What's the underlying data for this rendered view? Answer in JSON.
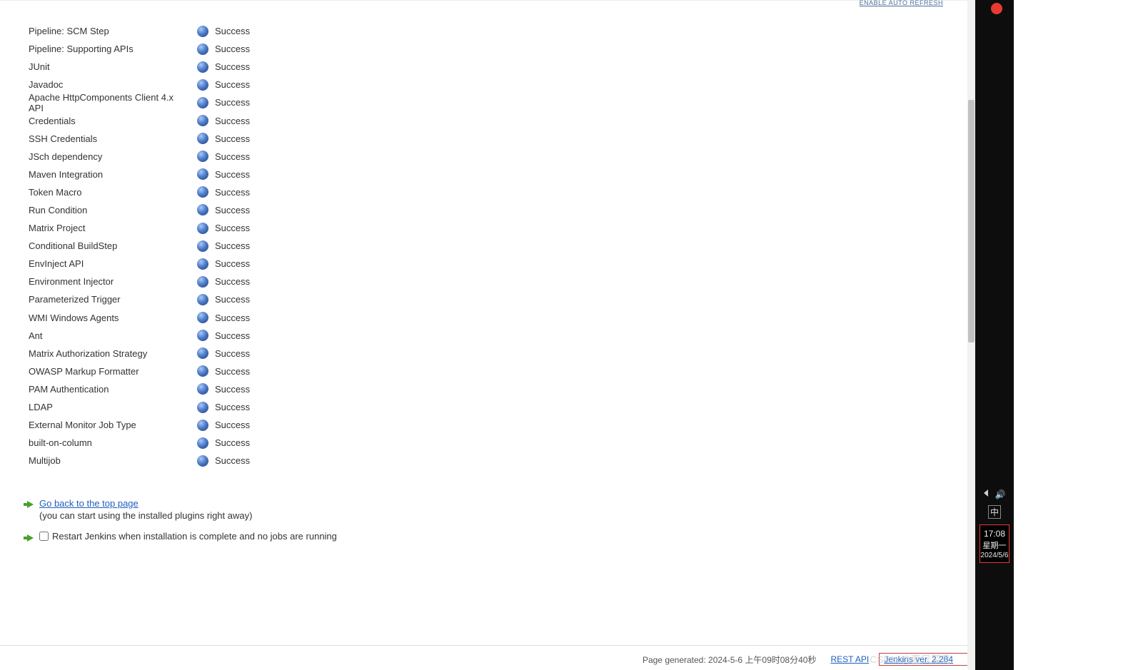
{
  "header": {
    "enable_auto_refresh": "ENABLE AUTO REFRESH"
  },
  "plugins": [
    {
      "name": "Pipeline: SCM Step",
      "status": "Success"
    },
    {
      "name": "Pipeline: Supporting APIs",
      "status": "Success"
    },
    {
      "name": "JUnit",
      "status": "Success"
    },
    {
      "name": "Javadoc",
      "status": "Success"
    },
    {
      "name": "Apache HttpComponents Client 4.x API",
      "status": "Success"
    },
    {
      "name": "Credentials",
      "status": "Success"
    },
    {
      "name": "SSH Credentials",
      "status": "Success"
    },
    {
      "name": "JSch dependency",
      "status": "Success"
    },
    {
      "name": "Maven Integration",
      "status": "Success"
    },
    {
      "name": "Token Macro",
      "status": "Success"
    },
    {
      "name": "Run Condition",
      "status": "Success"
    },
    {
      "name": "Matrix Project",
      "status": "Success"
    },
    {
      "name": "Conditional BuildStep",
      "status": "Success"
    },
    {
      "name": "EnvInject API",
      "status": "Success"
    },
    {
      "name": "Environment Injector",
      "status": "Success"
    },
    {
      "name": "Parameterized Trigger",
      "status": "Success"
    },
    {
      "name": "WMI Windows Agents",
      "status": "Success"
    },
    {
      "name": "Ant",
      "status": "Success"
    },
    {
      "name": "Matrix Authorization Strategy",
      "status": "Success"
    },
    {
      "name": "OWASP Markup Formatter",
      "status": "Success"
    },
    {
      "name": "PAM Authentication",
      "status": "Success"
    },
    {
      "name": "LDAP",
      "status": "Success"
    },
    {
      "name": "External Monitor Job Type",
      "status": "Success"
    },
    {
      "name": "built-on-column",
      "status": "Success"
    },
    {
      "name": "Multijob",
      "status": "Success"
    }
  ],
  "actions": {
    "go_back": "Go back to the top page",
    "go_back_sub": "(you can start using the installed plugins right away)",
    "restart_label": "Restart Jenkins when installation is complete and no jobs are running",
    "restart_checked": false
  },
  "footer": {
    "page_generated": "Page generated: 2024-5-6 上午09时08分40秒",
    "rest_api_label": "REST API",
    "jenkins_version": "Jenkins ver. 2.284"
  },
  "watermark": "CSDN @壹只菜鸟",
  "rail": {
    "ime": "中",
    "time": "17:08",
    "day": "星期一",
    "date": "2024/5/6"
  }
}
